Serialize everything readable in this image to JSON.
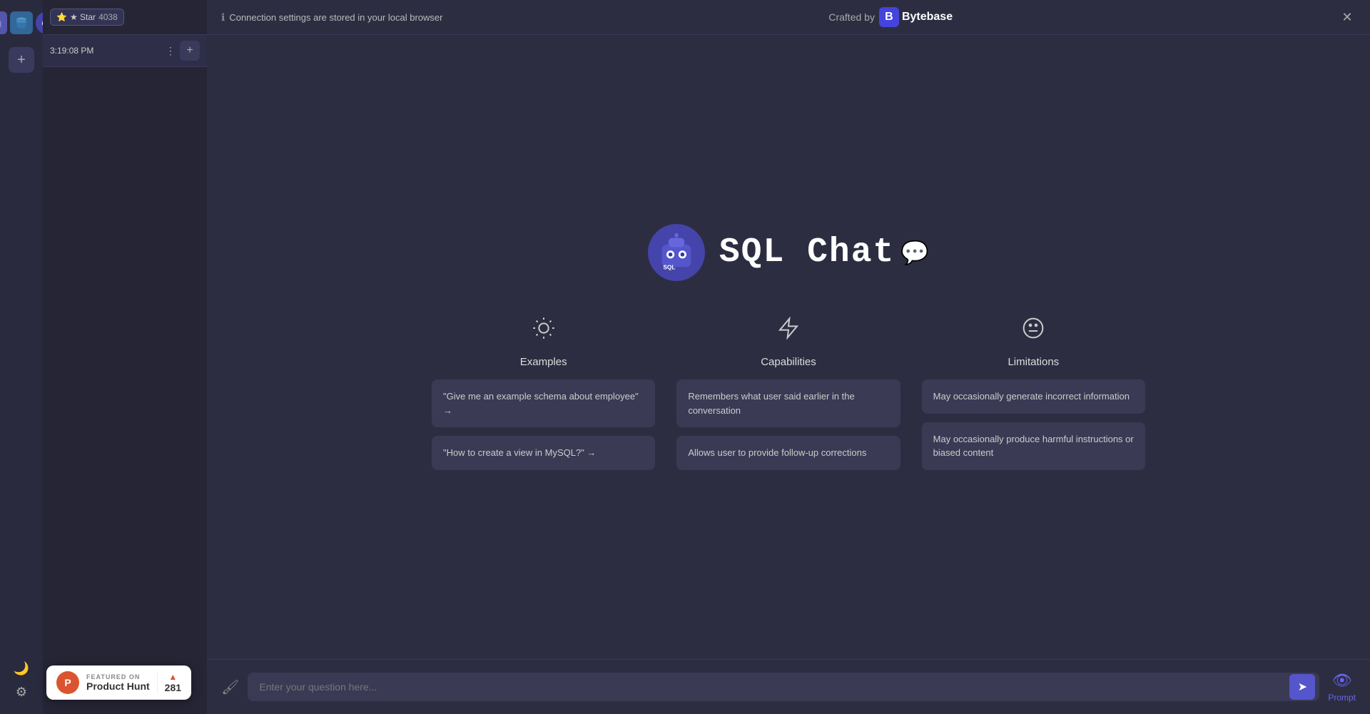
{
  "sidebar": {
    "add_label": "+",
    "moon_label": "🌙",
    "settings_label": "⚙"
  },
  "nav": {
    "star_label": "★ Star",
    "star_count": "4038",
    "session_label": "3:19:08 PM",
    "add_tab_label": "+"
  },
  "topbar": {
    "connection_notice": "Connection settings are stored in your local browser",
    "crafted_by": "Crafted by",
    "brand": "Bytebase",
    "close_label": "✕"
  },
  "hero": {
    "title": "SQL Chat",
    "bot_emoji": "🤖",
    "chat_emoji": "💬"
  },
  "columns": {
    "examples": {
      "icon": "☀",
      "title": "Examples",
      "cards": [
        "\"Give me an example schema about employee\" →",
        "\"How to create a view in MySQL?\" →"
      ]
    },
    "capabilities": {
      "icon": "⚡",
      "title": "Capabilities",
      "cards": [
        "Remembers what user said earlier in the conversation",
        "Allows user to provide follow-up corrections"
      ]
    },
    "limitations": {
      "icon": "😐",
      "title": "Limitations",
      "cards": [
        "May occasionally generate incorrect information",
        "May occasionally produce harmful instructions or biased content"
      ]
    }
  },
  "input": {
    "placeholder": "Enter your question here...",
    "send_icon": "➤",
    "brush_icon": "🖌",
    "prompt_label": "Prompt"
  },
  "product_hunt": {
    "featured_label": "FEATURED ON",
    "name": "Product Hunt",
    "count": "281",
    "logo_letter": "P"
  }
}
